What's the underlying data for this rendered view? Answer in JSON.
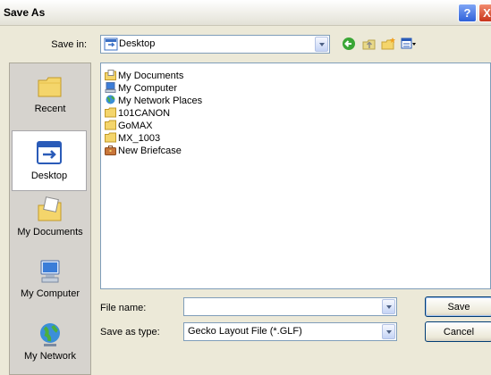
{
  "window": {
    "title": "Save As"
  },
  "title_buttons": {
    "help": "?",
    "close": "X"
  },
  "save_in": {
    "label": "Save in:",
    "value": "Desktop"
  },
  "places": [
    {
      "label": "Recent",
      "icon": "recent-folder-icon",
      "selected": false
    },
    {
      "label": "Desktop",
      "icon": "desktop-icon",
      "selected": true
    },
    {
      "label": "My Documents",
      "icon": "my-documents-icon",
      "selected": false
    },
    {
      "label": "My Computer",
      "icon": "my-computer-icon",
      "selected": false
    },
    {
      "label": "My Network",
      "icon": "my-network-icon",
      "selected": false
    }
  ],
  "files": [
    {
      "label": "My Documents",
      "icon": "my-documents-icon"
    },
    {
      "label": "My Computer",
      "icon": "my-computer-icon"
    },
    {
      "label": "My Network Places",
      "icon": "network-places-icon"
    },
    {
      "label": "101CANON",
      "icon": "folder-icon"
    },
    {
      "label": "GoMAX",
      "icon": "folder-icon"
    },
    {
      "label": "MX_1003",
      "icon": "folder-icon"
    },
    {
      "label": "New Briefcase",
      "icon": "briefcase-icon"
    }
  ],
  "file_name": {
    "label": "File name:",
    "value": ""
  },
  "save_as_type": {
    "label": "Save as type:",
    "value": "Gecko Layout File (*.GLF)"
  },
  "buttons": {
    "save": "Save",
    "cancel": "Cancel"
  },
  "colors": {
    "dialog_bg": "#ece9d8",
    "places_bg": "#d6d3ce",
    "field_border": "#7f9db9"
  }
}
